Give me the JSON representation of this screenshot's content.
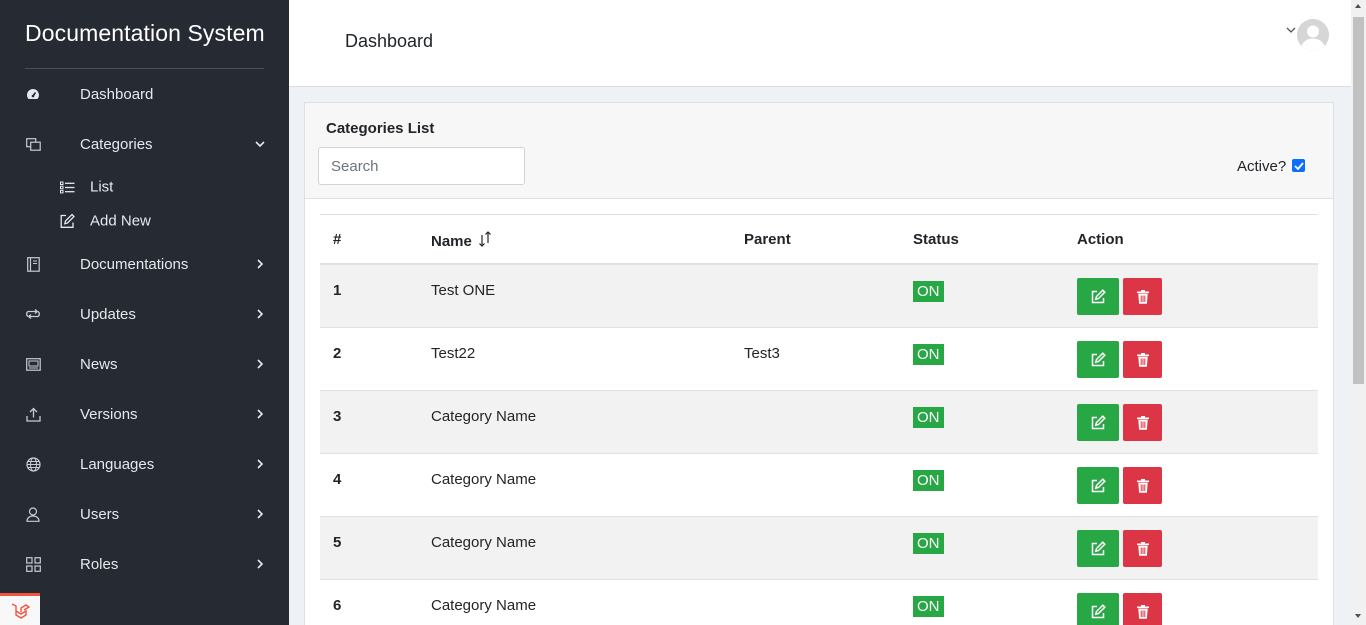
{
  "app": {
    "brand": "Documentation System"
  },
  "sidebar": {
    "items": [
      {
        "label": "Dashboard",
        "icon": "speedometer-icon"
      },
      {
        "label": "Categories",
        "icon": "copy-icon",
        "expanded": true,
        "children": [
          {
            "label": "List",
            "icon": "list-icon"
          },
          {
            "label": "Add New",
            "icon": "edit-icon"
          }
        ]
      },
      {
        "label": "Documentations",
        "icon": "book-icon"
      },
      {
        "label": "Updates",
        "icon": "sync-icon"
      },
      {
        "label": "News",
        "icon": "newspaper-icon"
      },
      {
        "label": "Versions",
        "icon": "upload-icon"
      },
      {
        "label": "Languages",
        "icon": "globe-icon"
      },
      {
        "label": "Users",
        "icon": "user-icon"
      },
      {
        "label": "Roles",
        "icon": "grid-icon"
      }
    ]
  },
  "header": {
    "title": "Dashboard"
  },
  "card": {
    "title": "Categories List",
    "search_placeholder": "Search",
    "active_label": "Active?",
    "active_checked": true
  },
  "table": {
    "columns": {
      "num": "#",
      "name": "Name",
      "parent": "Parent",
      "status": "Status",
      "action": "Action"
    },
    "rows": [
      {
        "num": "1",
        "name": "Test ONE",
        "parent": "",
        "status": "ON"
      },
      {
        "num": "2",
        "name": "Test22",
        "parent": "Test3",
        "status": "ON"
      },
      {
        "num": "3",
        "name": "Category Name",
        "parent": "",
        "status": "ON"
      },
      {
        "num": "4",
        "name": "Category Name",
        "parent": "",
        "status": "ON"
      },
      {
        "num": "5",
        "name": "Category Name",
        "parent": "",
        "status": "ON"
      },
      {
        "num": "6",
        "name": "Category Name",
        "parent": "",
        "status": "ON"
      }
    ]
  },
  "colors": {
    "sidebar_bg": "#252a33",
    "success": "#28a745",
    "danger": "#dc3545",
    "accent": "#0d6efd"
  }
}
